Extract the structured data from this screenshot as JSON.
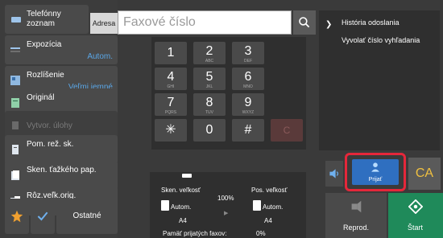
{
  "left": {
    "tel_list": "Telefónny zoznam",
    "items": [
      {
        "label": "Expozícia",
        "value": "Autom."
      },
      {
        "label": "Rozlíšenie",
        "value": "Veľmi jemné"
      },
      {
        "label": "Originál",
        "value": ""
      },
      {
        "label": "Vytvor. úlohy",
        "value": ""
      },
      {
        "label": "Pom. rež. sk.",
        "value": ""
      },
      {
        "label": "Sken. ťažkého pap.",
        "value": ""
      },
      {
        "label": "Rôz.veľk.orig.",
        "value": ""
      }
    ],
    "other_label": "Ostatné"
  },
  "address": {
    "adresa_label": "Adresa",
    "placeholder": "Faxové číslo"
  },
  "keypad": [
    {
      "d": "1",
      "s": ""
    },
    {
      "d": "2",
      "s": "ABC"
    },
    {
      "d": "3",
      "s": "DEF"
    },
    {
      "d": "4",
      "s": "GHI"
    },
    {
      "d": "5",
      "s": "JKL"
    },
    {
      "d": "6",
      "s": "MNO"
    },
    {
      "d": "7",
      "s": "PQRS"
    },
    {
      "d": "8",
      "s": "TUV"
    },
    {
      "d": "9",
      "s": "WXYZ"
    },
    {
      "d": "✳",
      "s": ""
    },
    {
      "d": "0",
      "s": ""
    },
    {
      "d": "#",
      "s": ""
    },
    {
      "d": "C",
      "s": ""
    }
  ],
  "scan": {
    "sken_velkost": "Sken. veľkosť",
    "pos_velkost": "Pos. veľkosť",
    "zoom": "100%",
    "sken_mode": "Autom.",
    "pos_mode": "Autom.",
    "sken_size": "A4",
    "pos_size": "A4",
    "memory_label": "Pamäť prijatých faxov:",
    "memory_value": "0%"
  },
  "right": {
    "history": "História odoslania",
    "recall": "Vyvolať číslo vyhľadania",
    "prijat": "Prijať",
    "ca": "CA",
    "reprod": "Reprod.",
    "start": "Štart"
  }
}
